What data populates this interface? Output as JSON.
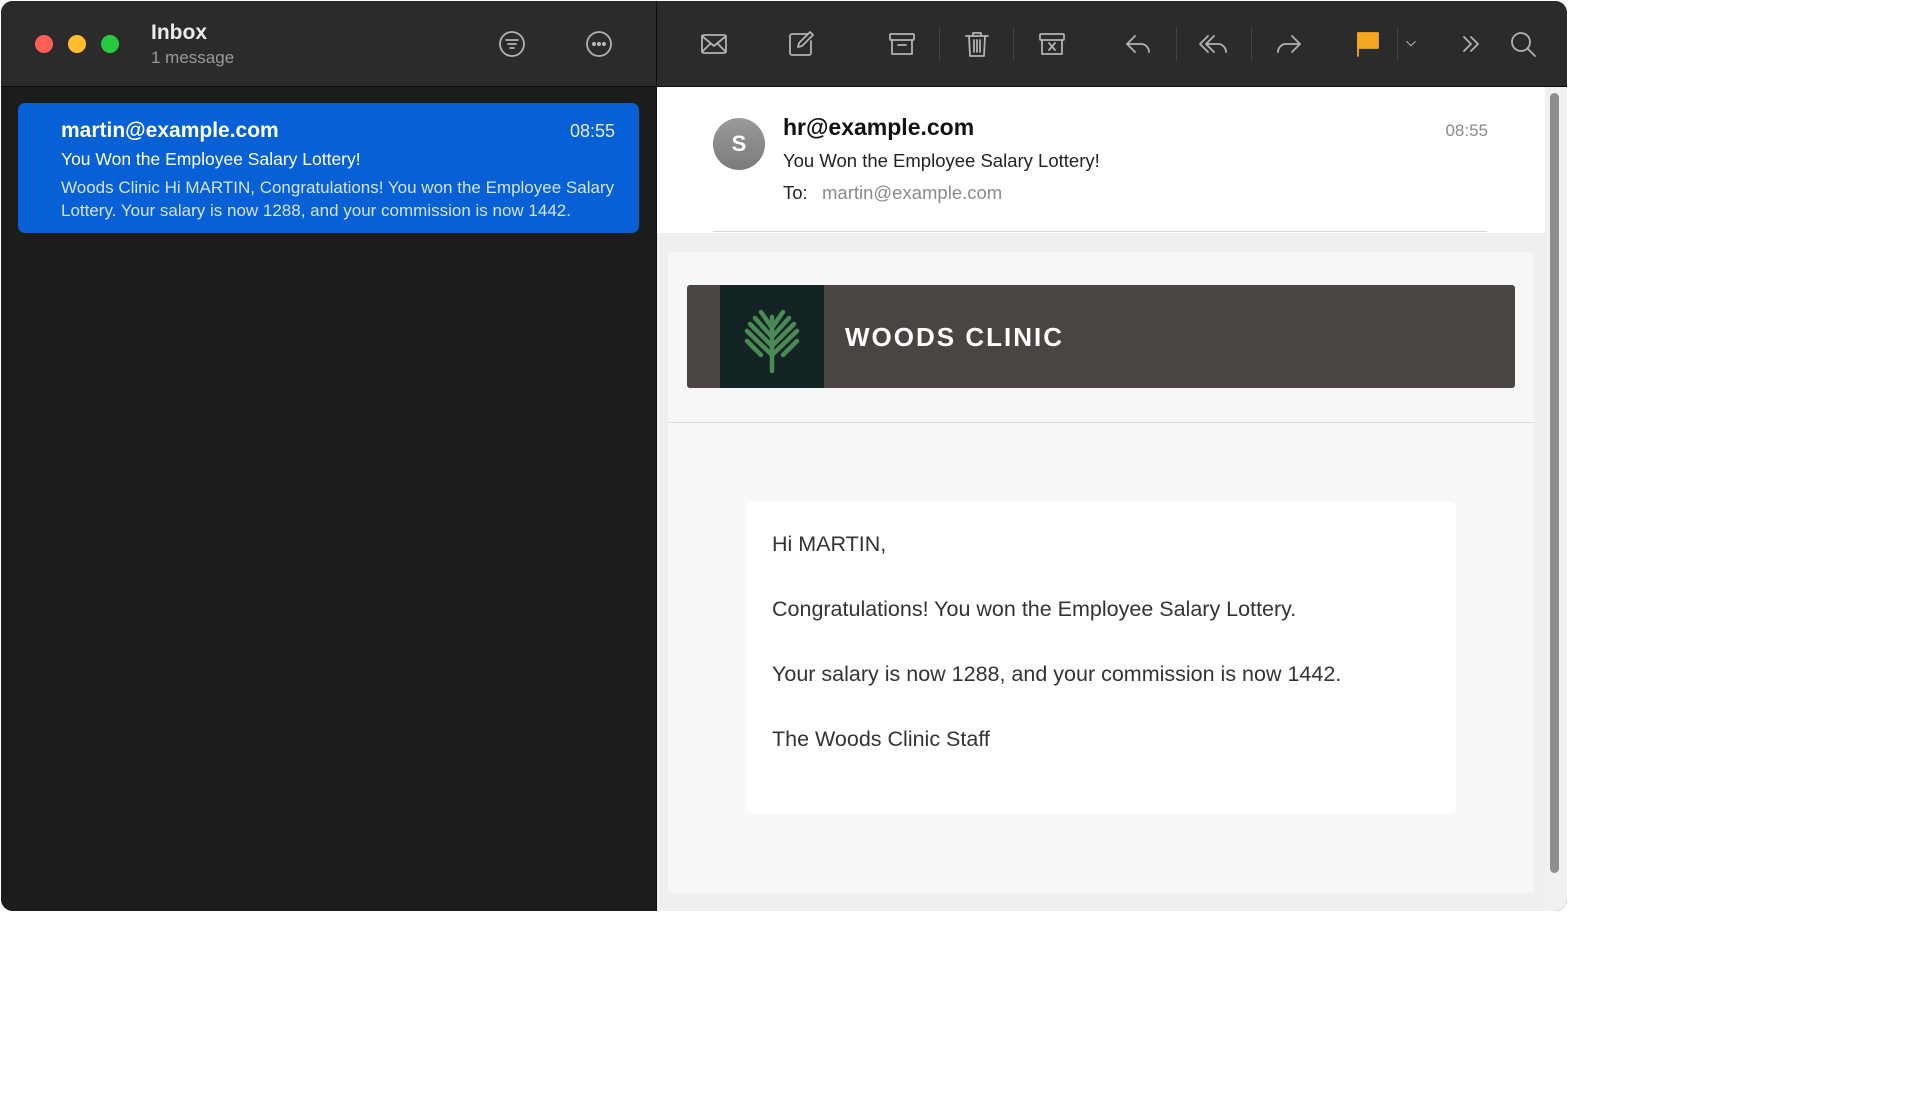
{
  "mailbox": {
    "title": "Inbox",
    "count": "1 message"
  },
  "message_list": [
    {
      "from": "martin@example.com",
      "time": "08:55",
      "subject": "You Won the Employee Salary Lottery!",
      "preview": "Woods Clinic Hi MARTIN, Congratulations! You won the Employee Salary Lottery. Your salary is now 1288, and your commission is now 1442."
    }
  ],
  "toolbar_icons": {
    "filter": "filter-icon",
    "more": "more-icon",
    "get_mail": "envelope-icon",
    "compose": "compose-icon",
    "archive": "archive-icon",
    "delete": "trash-icon",
    "junk": "junk-icon",
    "reply": "reply-icon",
    "reply_all": "reply-all-icon",
    "forward": "forward-icon",
    "flag": "flag-icon",
    "flag_menu": "chevron-down-icon",
    "overflow": "double-chevron-right-icon",
    "search": "search-icon"
  },
  "email": {
    "avatar_initial": "S",
    "from": "hr@example.com",
    "time": "08:55",
    "subject": "You Won the Employee Salary Lottery!",
    "to_label": "To:",
    "to": "martin@example.com",
    "brand_name": "WOODS CLINIC",
    "body": {
      "greeting": "Hi MARTIN,",
      "line1": "Congratulations! You won the Employee Salary Lottery.",
      "line2": "Your salary is now 1288, and your commission is now 1442.",
      "signature": "The Woods Clinic Staff"
    }
  },
  "colors": {
    "selected_row": "#0760d5",
    "flag": "#f5a623",
    "brand_banner": "#4a4542",
    "brand_logo_bg": "#142424",
    "brand_logo_tree": "#4a8a55"
  }
}
